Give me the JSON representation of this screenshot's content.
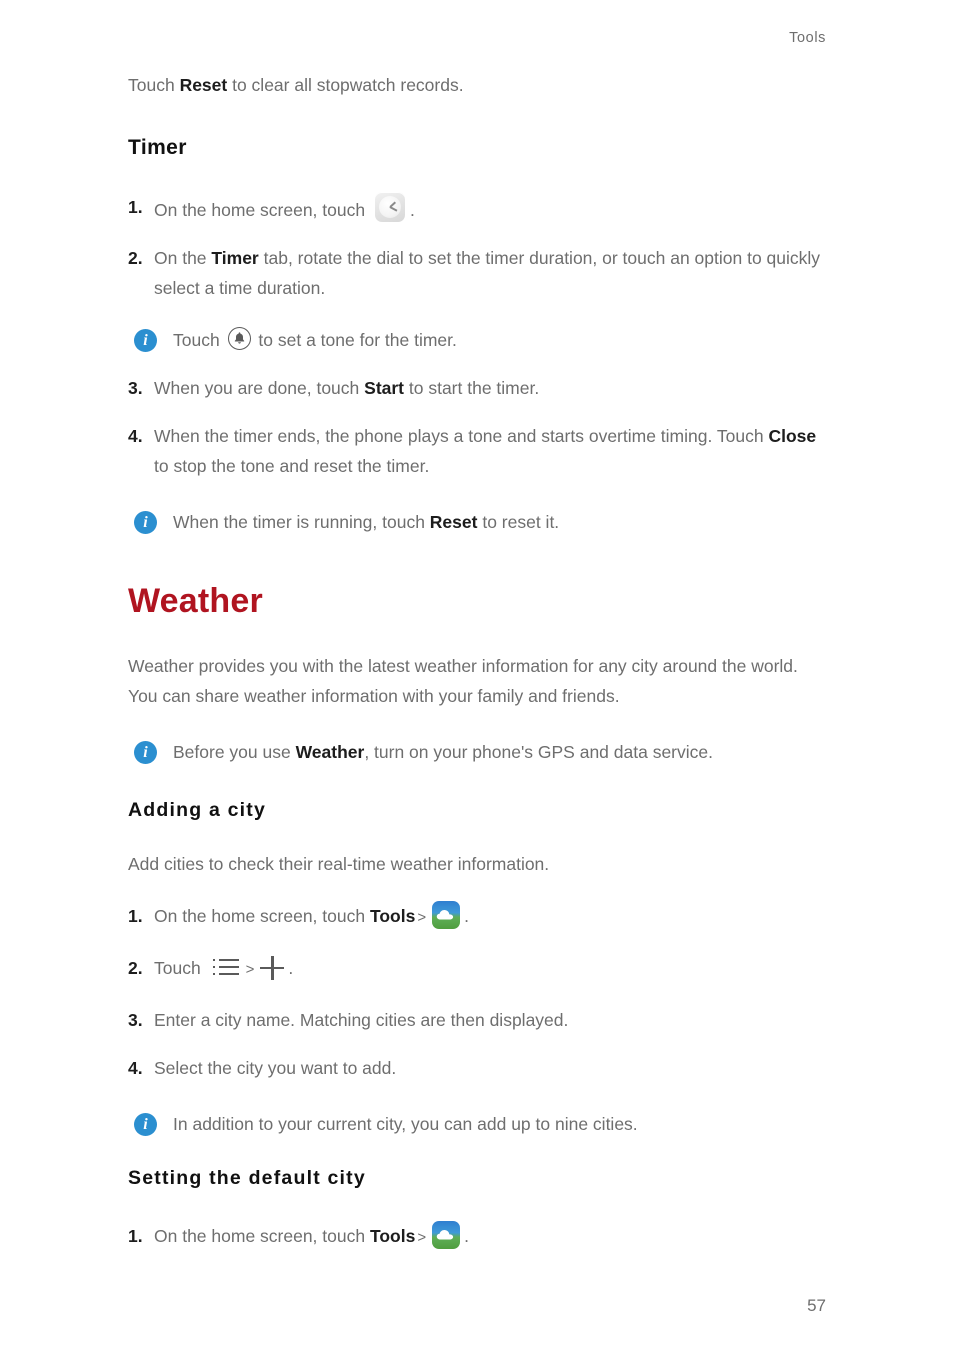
{
  "header": {
    "running_head": "Tools"
  },
  "footer": {
    "page_number": "57"
  },
  "colors": {
    "section_title": "#b01420",
    "body_text": "#6e6e6e",
    "bold_text": "#1d1d1d",
    "info_badge": "#2b8fd0"
  },
  "intro": {
    "text_before": "Touch ",
    "bold": "Reset",
    "text_after": " to clear all stopwatch records."
  },
  "timer": {
    "heading": "Timer",
    "steps": [
      {
        "num": "1.",
        "before": "On the home screen, touch ",
        "icon": "clock-app-icon",
        "after": "."
      },
      {
        "num": "2.",
        "before": "On the ",
        "bold": "Timer",
        "after": " tab, rotate the dial to set the timer duration, or touch an option to quickly select a time duration."
      },
      {
        "num": "3.",
        "before": "When you are done, touch ",
        "bold": "Start",
        "after": " to start the timer."
      },
      {
        "num": "4.",
        "before": "When the timer ends, the phone plays a tone and starts overtime timing. Touch ",
        "bold": "Close",
        "after": " to stop the tone and reset the timer."
      }
    ],
    "note_tone": {
      "before": "Touch ",
      "icon": "bell-icon",
      "after": " to set a tone for the timer."
    },
    "note_reset": {
      "before": "When the timer is running, touch ",
      "bold": "Reset",
      "after": " to reset it."
    }
  },
  "weather": {
    "heading": "Weather",
    "intro": "Weather provides you with the latest weather information for any city around the world. You can share weather information with your family and friends.",
    "note_gps": {
      "before": "Before you use ",
      "bold": "Weather",
      "after": ", turn on your phone's GPS and data service."
    },
    "adding_a_city": {
      "heading": "Adding  a  city",
      "intro": "Add cities to check their real-time weather information.",
      "steps": [
        {
          "num": "1.",
          "before": "On the home screen, touch ",
          "bold": "Tools",
          "separator": ">",
          "icon": "weather-app-icon",
          "after": "."
        },
        {
          "num": "2.",
          "before": "Touch ",
          "icon_list": "list-icon",
          "separator": ">",
          "icon_plus": "plus-icon",
          "after": "."
        },
        {
          "num": "3.",
          "before": "Enter a city name. Matching cities are then displayed."
        },
        {
          "num": "4.",
          "before": "Select the city you want to add."
        }
      ],
      "note_nine": "In addition to your current city, you can add up to nine cities."
    },
    "setting_default_city": {
      "heading": "Setting  the  default  city",
      "steps": [
        {
          "num": "1.",
          "before": "On the home screen, touch ",
          "bold": "Tools",
          "separator": ">",
          "icon": "weather-app-icon",
          "after": "."
        }
      ]
    }
  }
}
